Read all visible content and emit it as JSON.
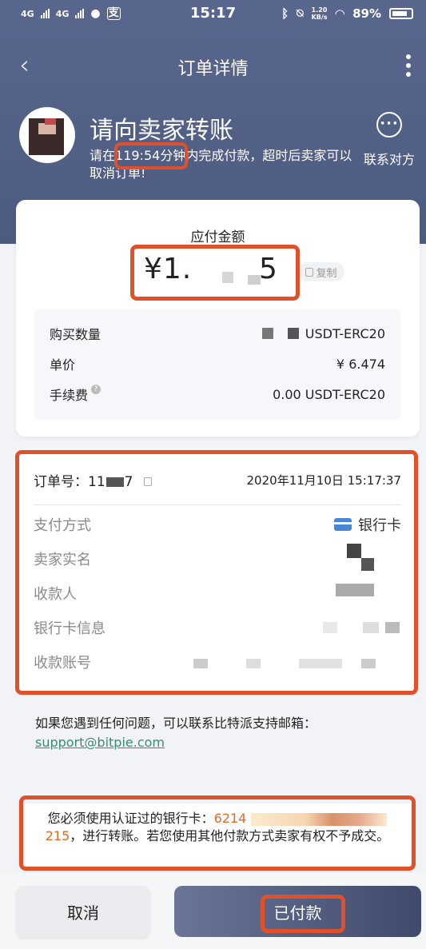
{
  "status_bar": {
    "network_1": "4G",
    "network_2": "4G",
    "app_badge": "支",
    "time": "15:17",
    "speed_value": "1.20",
    "speed_unit": "KB/s",
    "battery": "89%"
  },
  "nav": {
    "title": "订单详情"
  },
  "header": {
    "title": "请向卖家转账",
    "countdown_prefix": "请在",
    "countdown_time": "119:54",
    "countdown_suffix": "分钟内完成付款，超时后卖家可以取消订单!",
    "contact_label": "联系对方"
  },
  "amount_card": {
    "label": "应付金额",
    "amount_prefix": "¥1.",
    "amount_suffix": "5",
    "copy_label": "复制",
    "rows": [
      {
        "label": "购买数量",
        "value": "USDT-ERC20"
      },
      {
        "label": "单价",
        "value": "¥ 6.474"
      },
      {
        "label": "手续费",
        "value": "0.00 USDT-ERC20",
        "help": "?"
      }
    ]
  },
  "order_card": {
    "order_no_label": "订单号：",
    "order_no_visible_1": "11",
    "order_no_visible_2": "7",
    "timestamp": "2020年11月10日 15:17:37",
    "rows": [
      {
        "label": "支付方式",
        "value": "银行卡"
      },
      {
        "label": "卖家实名"
      },
      {
        "label": "收款人"
      },
      {
        "label": "银行卡信息"
      },
      {
        "label": "收款账号"
      }
    ]
  },
  "help": {
    "text": "如果您遇到任何问题，可以联系比特派支持邮箱：",
    "email": "support@bitpie.com"
  },
  "warning": {
    "prefix": "您必须使用认证过的银行卡：",
    "card_start": "6214",
    "card_end": "215",
    "suffix": "，进行转账。若您使用其他付款方式卖家有权不予成交。"
  },
  "actions": {
    "cancel": "取消",
    "paid": "已付款"
  },
  "colors": {
    "hero": "#56638a",
    "highlight": "#e2502a",
    "accent_orange": "#e5691c",
    "link": "#3a8d6e"
  }
}
